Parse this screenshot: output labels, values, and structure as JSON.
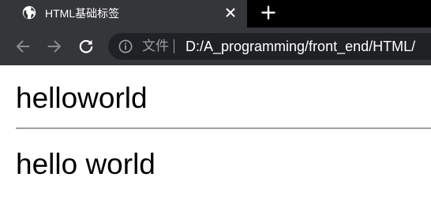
{
  "tab": {
    "title": "HTML基础标签",
    "favicon": "globe-icon"
  },
  "toolbar": {
    "back_icon": "back-arrow-icon",
    "forward_icon": "forward-arrow-icon",
    "reload_icon": "reload-icon",
    "security_label": "文件",
    "url": "D:/A_programming/front_end/HTML/"
  },
  "page": {
    "heading_1": "helloworld",
    "heading_2": "hello world"
  },
  "colors": {
    "tab_strip": "#000000",
    "tab_active": "#35363a",
    "toolbar": "#35363a",
    "omnibox": "#202124",
    "muted_text": "#9aa0a6",
    "hr": "#9e9e9e"
  }
}
